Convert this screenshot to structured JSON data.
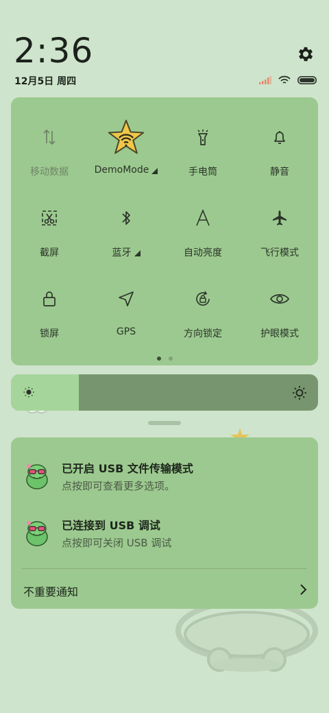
{
  "header": {
    "time": "2:36",
    "date": "12月5日 周四"
  },
  "icons": {
    "settings": "gear-icon",
    "signal": "signal-icon",
    "wifi": "wifi-icon",
    "battery": "battery-icon"
  },
  "quick_settings": {
    "tiles": [
      {
        "label": "移动数据",
        "icon": "mobile-data-icon"
      },
      {
        "label": "DemoMode",
        "icon": "wifi-star-icon"
      },
      {
        "label": "手电筒",
        "icon": "flashlight-icon"
      },
      {
        "label": "静音",
        "icon": "bell-icon"
      },
      {
        "label": "截屏",
        "icon": "screenshot-icon"
      },
      {
        "label": "蓝牙",
        "icon": "bluetooth-icon"
      },
      {
        "label": "自动亮度",
        "icon": "auto-brightness-icon"
      },
      {
        "label": "飞行模式",
        "icon": "airplane-icon"
      },
      {
        "label": "锁屏",
        "icon": "lock-icon"
      },
      {
        "label": "GPS",
        "icon": "gps-icon"
      },
      {
        "label": "方向锁定",
        "icon": "rotation-lock-icon"
      },
      {
        "label": "护眼模式",
        "icon": "eye-icon"
      }
    ],
    "pages": 2,
    "current_page": 1
  },
  "brightness": {
    "level": 0.22
  },
  "notifications": [
    {
      "title": "已开启 USB 文件传输模式",
      "subtitle": "点按即可查看更多选项。"
    },
    {
      "title": "已连接到 USB 调试",
      "subtitle": "点按即可关闭 USB 调试"
    }
  ],
  "unimportant_label": "不重要通知",
  "colors": {
    "background": "#cfe4cc",
    "panel": "#9cc98f",
    "slider_track": "#77966f",
    "slider_fill": "#a6d59b",
    "star": "#f0c74a"
  }
}
